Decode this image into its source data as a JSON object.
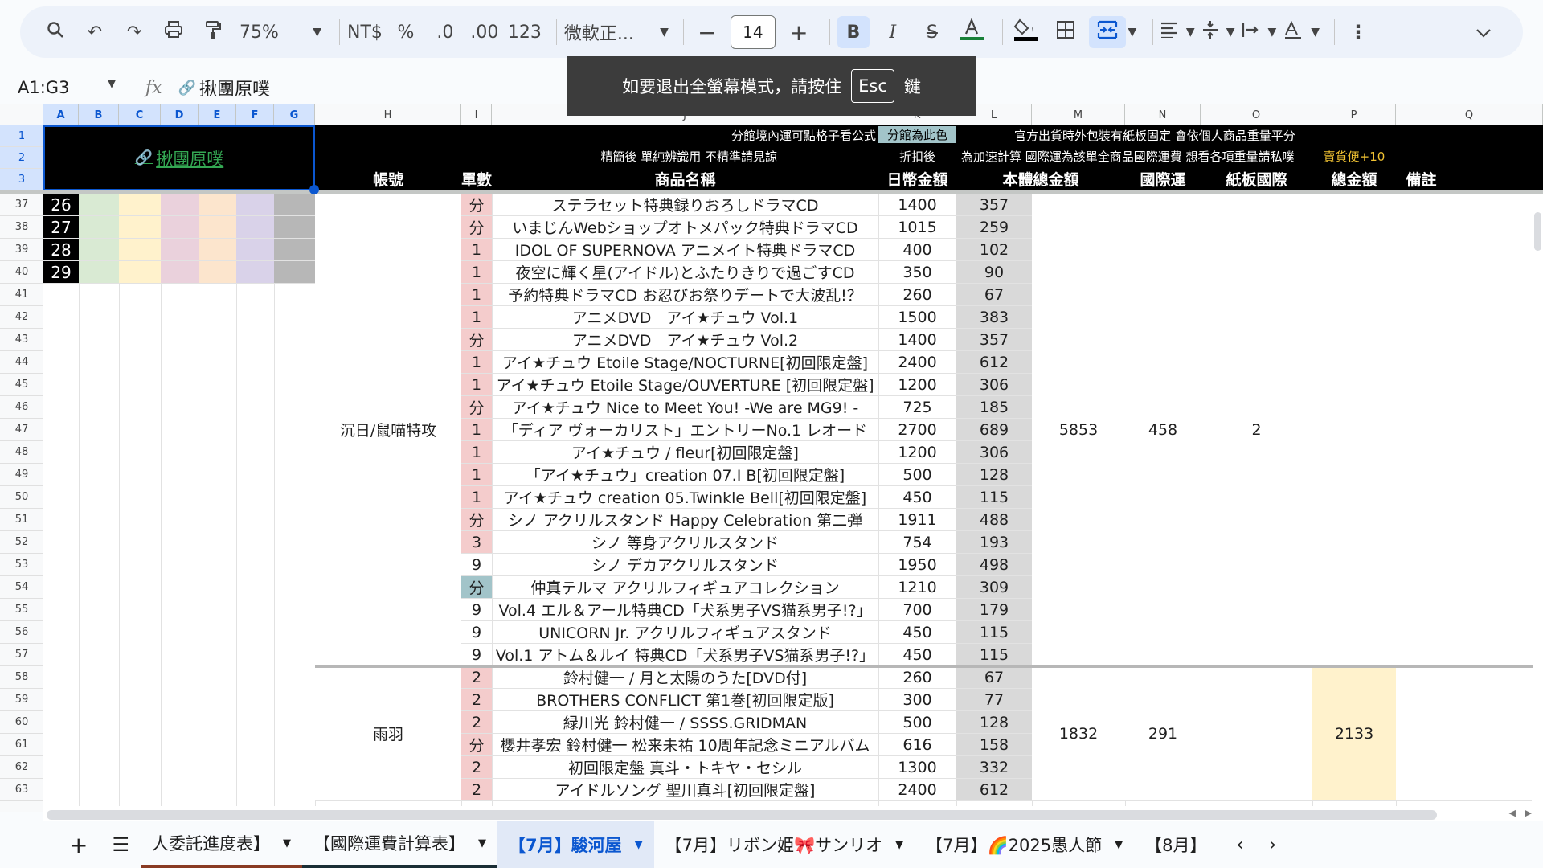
{
  "toolbar": {
    "zoom": "75%",
    "currency": "NT$",
    "percent": "%",
    "dec_decrease": ".0",
    "dec_increase": ".00",
    "number_format": "123",
    "font_name": "微軟正...",
    "font_size": "14",
    "bold": "B",
    "italic": "I"
  },
  "formula_bar": {
    "range": "A1:G3",
    "fx": "fx",
    "content": "揪團原噗"
  },
  "fullscreen_notice": {
    "text": "如要退出全螢幕模式，請按住",
    "key": "Esc",
    "suffix": "鍵"
  },
  "columns": [
    "A",
    "B",
    "C",
    "D",
    "E",
    "F",
    "G",
    "H",
    "I",
    "J",
    "K",
    "L",
    "M",
    "N",
    "O",
    "P",
    "Q"
  ],
  "selection_link": "揪團原噗",
  "header": {
    "r1_k": "分館境內運可點格子看公式",
    "r1_k_badge": "分館為此色",
    "r1_m": "官方出貨時外包裝有紙板固定 會依個人商品重量平分",
    "r2_j": "精簡後 單純辨識用 不精準請見諒",
    "r2_k": "折扣後",
    "r2_m": "為加速計算 國際運為該單全商品國際運費 想看各項重量請私噗",
    "r2_p": "賣貨便+10",
    "col_account": "帳號",
    "col_qty": "單數",
    "col_name": "商品名稱",
    "col_jpy": "日幣金額",
    "col_total": "本體總金額",
    "col_intl": "國際運",
    "col_board": "紙板國際",
    "col_sum": "總金額",
    "col_note": "備註"
  },
  "left_rows": [
    {
      "row": "37",
      "num": "26"
    },
    {
      "row": "38",
      "num": "27"
    },
    {
      "row": "39",
      "num": "28"
    },
    {
      "row": "40",
      "num": "29"
    }
  ],
  "row_numbers": [
    "41",
    "42",
    "43",
    "44",
    "45",
    "46",
    "47",
    "48",
    "49",
    "50",
    "51",
    "52",
    "53",
    "54",
    "55",
    "56",
    "57",
    "58",
    "59",
    "60",
    "61",
    "62",
    "63"
  ],
  "group1": {
    "account": "沉日/鼠喵特攻",
    "total": "5853",
    "intl": "458",
    "board": "2",
    "items": [
      {
        "q": "分",
        "name": "ステラセット特典録りおろしドラマCD",
        "jpy": "1400",
        "l": "357"
      },
      {
        "q": "分",
        "name": "いまじんWebショップオトメパック特典ドラマCD",
        "jpy": "1015",
        "l": "259"
      },
      {
        "q": "1",
        "name": "IDOL OF SUPERNOVA アニメイト特典ドラマCD",
        "jpy": "400",
        "l": "102"
      },
      {
        "q": "1",
        "name": "夜空に輝く星(アイドル)とふたりきりで過ごすCD",
        "jpy": "350",
        "l": "90"
      },
      {
        "q": "1",
        "name": "予約特典ドラマCD お忍びお祭りデートで大波乱!？",
        "jpy": "260",
        "l": "67"
      },
      {
        "q": "1",
        "name": "アニメDVD　アイ★チュウ Vol.1",
        "jpy": "1500",
        "l": "383"
      },
      {
        "q": "分",
        "name": "アニメDVD　アイ★チュウ Vol.2",
        "jpy": "1400",
        "l": "357"
      },
      {
        "q": "1",
        "name": "アイ★チュウ Etoile Stage/NOCTURNE[初回限定盤]",
        "jpy": "2400",
        "l": "612"
      },
      {
        "q": "1",
        "name": "アイ★チュウ Etoile Stage/OUVERTURE [初回限定盤]",
        "jpy": "1200",
        "l": "306"
      },
      {
        "q": "分",
        "name": "アイ★チュウ Nice to Meet You! -We are MG9! -",
        "jpy": "725",
        "l": "185"
      },
      {
        "q": "1",
        "name": "「ディア ヴォーカリスト」エントリーNo.1 レオード",
        "jpy": "2700",
        "l": "689"
      },
      {
        "q": "1",
        "name": "アイ★チュウ / fleur[初回限定盤]",
        "jpy": "1200",
        "l": "306"
      },
      {
        "q": "1",
        "name": "「アイ★チュウ」creation 07.I B[初回限定盤]",
        "jpy": "500",
        "l": "128"
      },
      {
        "q": "1",
        "name": "アイ★チュウ creation 05.Twinkle Bell[初回限定盤]",
        "jpy": "450",
        "l": "115"
      },
      {
        "q": "分",
        "name": "シノ アクリルスタンド Happy Celebration 第二弾",
        "jpy": "1911",
        "l": "488"
      },
      {
        "q": "3",
        "name": "シノ 等身アクリルスタンド",
        "jpy": "754",
        "l": "193"
      },
      {
        "q": "9",
        "name": "シノ デカアクリルスタンド",
        "jpy": "1950",
        "l": "498"
      },
      {
        "q": "分",
        "name": "仲真テルマ アクリルフィギュアコレクション",
        "jpy": "1210",
        "l": "309"
      },
      {
        "q": "9",
        "name": "Vol.4 エル＆アール特典CD「犬系男子VS猫系男子!?」",
        "jpy": "700",
        "l": "179"
      },
      {
        "q": "9",
        "name": "UNICORN Jr. アクリルフィギュアスタンド",
        "jpy": "450",
        "l": "115"
      },
      {
        "q": "9",
        "name": "Vol.1 アトム＆ルイ 特典CD「犬系男子VS猫系男子!?」",
        "jpy": "450",
        "l": "115"
      }
    ]
  },
  "group2": {
    "account": "雨羽",
    "total": "1832",
    "intl": "291",
    "sum": "2133",
    "items": [
      {
        "q": "2",
        "name": "鈴村健一 / 月と太陽のうた[DVD付]",
        "jpy": "260",
        "l": "67"
      },
      {
        "q": "2",
        "name": "BROTHERS CONFLICT 第1巻[初回限定版]",
        "jpy": "300",
        "l": "77"
      },
      {
        "q": "2",
        "name": "緑川光 鈴村健一 / SSSS.GRIDMAN",
        "jpy": "500",
        "l": "128"
      },
      {
        "q": "分",
        "name": "櫻井孝宏 鈴村健一 松来未祐 10周年記念ミニアルバム",
        "jpy": "616",
        "l": "158"
      },
      {
        "q": "2",
        "name": "初回限定盤 真斗・トキヤ・セシル",
        "jpy": "1300",
        "l": "332"
      },
      {
        "q": "2",
        "name": "アイドルソング 聖川真斗[初回限定盤]",
        "jpy": "2400",
        "l": "612"
      }
    ]
  },
  "tabs": [
    "人委託進度表】",
    "【國際運費計算表】",
    "【7月】駿河屋",
    "【7月】リボン姫🎀サンリオ",
    "【7月】🌈2025愚人節",
    "【8月】"
  ],
  "colors": {
    "accent": "#0b57d0",
    "pink": "#f4cccc",
    "teal": "#a2c4c9",
    "grey": "#d9d9d9",
    "yellow": "#fff2cc"
  }
}
